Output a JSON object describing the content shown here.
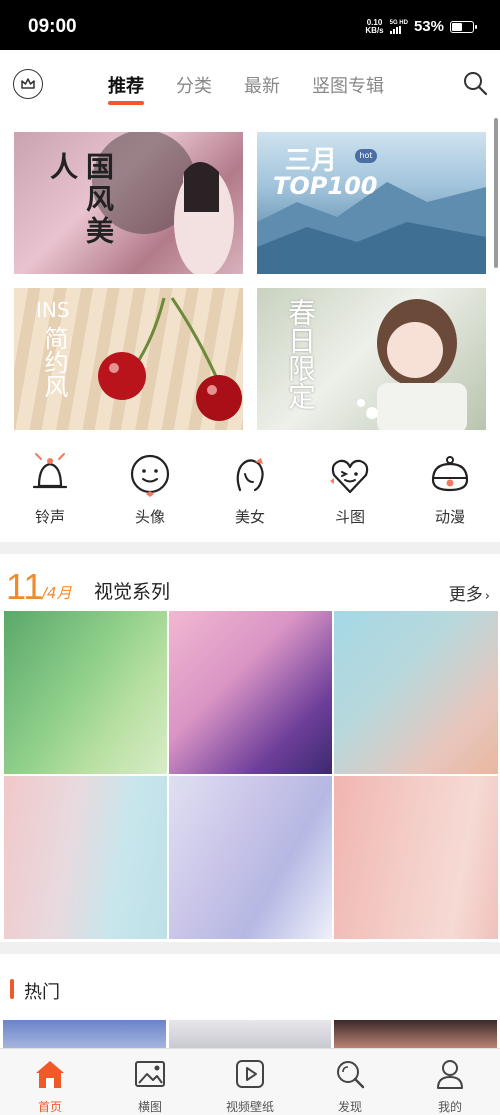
{
  "status_bar": {
    "time": "09:00",
    "net_speed_value": "0.10",
    "net_speed_unit": "KB/s",
    "network": "5G HD",
    "battery_percent": "53%",
    "battery_level": 0.53
  },
  "header": {
    "tabs": [
      {
        "label": "推荐",
        "active": true
      },
      {
        "label": "分类",
        "active": false
      },
      {
        "label": "最新",
        "active": false
      },
      {
        "label": "竖图专辑",
        "active": false
      }
    ],
    "accent_color": "#f05a28"
  },
  "banners": [
    {
      "text": "国风美人"
    },
    {
      "title": "三月",
      "subtitle": "TOP100",
      "badge": "hot"
    },
    {
      "title": "INS",
      "subtitle": "简约风"
    },
    {
      "text": "春日限定"
    }
  ],
  "categories": [
    {
      "label": "铃声",
      "icon": "bell-icon"
    },
    {
      "label": "头像",
      "icon": "smiley-face-icon"
    },
    {
      "label": "美女",
      "icon": "girl-head-icon"
    },
    {
      "label": "斗图",
      "icon": "winking-heart-icon"
    },
    {
      "label": "动漫",
      "icon": "anime-cat-icon"
    }
  ],
  "visual_series": {
    "day": "11",
    "month": "/4月",
    "title": "视觉系列",
    "more": "更多",
    "cells": [
      {
        "gradient": "linear-gradient(125deg,#5aa86a 0%,#8fcf8a 45%,#b8e0a2 70%,#d8ecc8 100%)"
      },
      {
        "gradient": "linear-gradient(135deg,#f2b8d0 0%,#d994c5 40%,#6e3f9a 75%,#3b2a6f 100%)"
      },
      {
        "gradient": "linear-gradient(135deg,#a4d8e6 0%,#b8d8dc 40%,#e8c6bd 75%,#e9b79f 100%)"
      },
      {
        "gradient": "linear-gradient(100deg,#f1c8c8 0%,#e8dadf 40%,#c7e6ec 70%,#bfe0e8 100%)"
      },
      {
        "gradient": "linear-gradient(120deg,#dfe0f2 0%,#c9c4e8 40%,#b4b8e3 65%,#eef0fa 100%)"
      },
      {
        "gradient": "linear-gradient(100deg,#f1b5b0 0%,#f4cdc7 45%,#f6dad5 75%,#f1c1bb 100%)"
      }
    ]
  },
  "hot": {
    "title": "热门"
  },
  "bottom_nav": [
    {
      "label": "首页",
      "icon": "home-icon",
      "active": true
    },
    {
      "label": "横图",
      "icon": "landscape-image-icon",
      "active": false
    },
    {
      "label": "视频壁纸",
      "icon": "video-play-icon",
      "active": false
    },
    {
      "label": "发现",
      "icon": "discover-search-icon",
      "active": false
    },
    {
      "label": "我的",
      "icon": "profile-icon",
      "active": false
    }
  ]
}
